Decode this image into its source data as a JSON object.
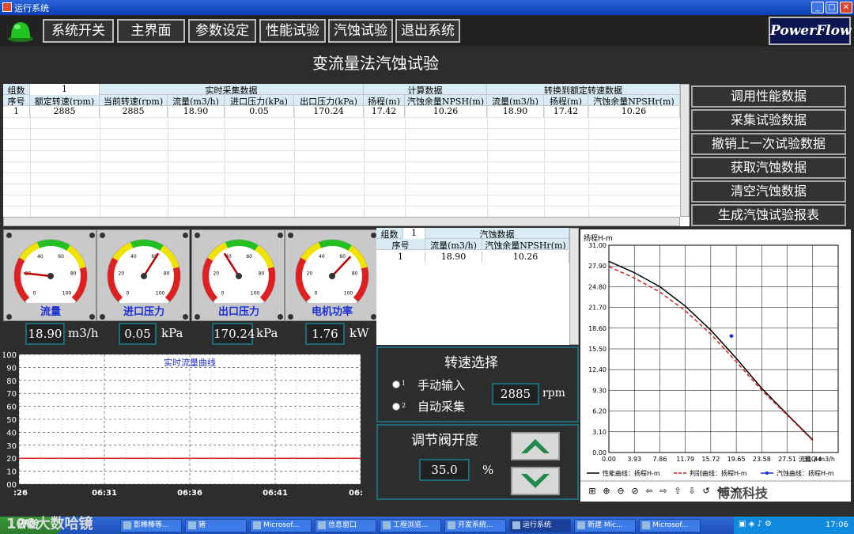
{
  "window": {
    "title": "运行系统"
  },
  "menu": {
    "items": [
      "系统开关",
      "主界面",
      "参数设定",
      "性能试验",
      "汽蚀试验",
      "退出系统"
    ],
    "logo": "PowerFlow"
  },
  "page": {
    "title": "变流量法汽蚀试验"
  },
  "table": {
    "group_label": "组数",
    "group_value": "1",
    "sections": [
      "实时采集数据",
      "计算数据",
      "转换到额定转速数据"
    ],
    "columns": [
      "序号",
      "额定转速(rpm)",
      "当前转速(rpm)",
      "流量(m3/h)",
      "进口压力(kPa)",
      "出口压力(kPa)",
      "扬程(m)",
      "汽蚀余量NPSH(m)",
      "流量(m3/h)",
      "扬程(m)",
      "汽蚀余量NPSHr(m)"
    ],
    "rows": [
      [
        "1",
        "2885",
        "2885",
        "18.90",
        "0.05",
        "170.24",
        "17.42",
        "10.26",
        "18.90",
        "17.42",
        "10.26"
      ]
    ]
  },
  "actions": [
    "调用性能数据",
    "采集试验数据",
    "撤销上一次试验数据",
    "获取汽蚀数据",
    "清空汽蚀数据",
    "生成汽蚀试验报表"
  ],
  "gauges": [
    {
      "label": "流量",
      "value": "18.90",
      "unit": "m3/h",
      "level": 0.19,
      "ticks": [
        "0",
        "20",
        "40",
        "60",
        "80",
        "100"
      ]
    },
    {
      "label": "进口压力",
      "value": "0.05",
      "unit": "kPa",
      "level": 0.62,
      "ticks": [
        "0",
        "20",
        "40",
        "60",
        "80",
        "100"
      ]
    },
    {
      "label": "出口压力",
      "value": "170.24",
      "unit": "kPa",
      "level": 0.38,
      "ticks": [
        "0",
        "20",
        "40",
        "60",
        "80",
        "100"
      ]
    },
    {
      "label": "电机功率",
      "value": "1.76",
      "unit": "kW",
      "level": 0.66,
      "ticks": [
        "0",
        "20",
        "40",
        "60",
        "80",
        "100"
      ]
    }
  ],
  "npsh_table": {
    "group_label": "组数",
    "group_value": "1",
    "section": "汽蚀数据",
    "columns": [
      "序号",
      "流量(m3/h)",
      "汽蚀余量NPSHr(m)"
    ],
    "rows": [
      [
        "1",
        "18.90",
        "10.26"
      ]
    ]
  },
  "trend": {
    "title": "实时流量曲线",
    "y_ticks": [
      "100",
      "90",
      "80",
      "70",
      "60",
      "50",
      "40",
      "30",
      "20",
      "10",
      "00"
    ],
    "x_ticks": [
      ":26",
      "06:31",
      "06:36",
      "06:41",
      "06:"
    ],
    "level": 20
  },
  "speed": {
    "title": "转速选择",
    "options": [
      {
        "num": "1",
        "label": "手动输入"
      },
      {
        "num": "2",
        "label": "自动采集"
      }
    ],
    "value": "2885",
    "unit": "rpm"
  },
  "valve": {
    "title": "调节阀开度",
    "value": "35.0",
    "unit": "%"
  },
  "chart_data": {
    "type": "line",
    "ylabel": "扬程H-m",
    "xlabel": "流量Q-m3/h",
    "y_ticks": [
      "31.00",
      "27.90",
      "24.80",
      "21.70",
      "18.60",
      "15.50",
      "12.40",
      "9.30",
      "6.20",
      "3.10",
      "0.00"
    ],
    "x_ticks": [
      "0.00",
      "3.93",
      "7.86",
      "11.79",
      "15.72",
      "19.65",
      "23.58",
      "27.51",
      "31.44"
    ],
    "ylim": [
      0,
      31
    ],
    "xlim": [
      0,
      35.37
    ],
    "grid": true,
    "series": [
      {
        "name": "性能曲线：扬程H-m",
        "color": "#000000",
        "style": "solid",
        "x": [
          0,
          3.93,
          7.86,
          11.79,
          15.72,
          19.65,
          23.58,
          27.51,
          31.44
        ],
        "y": [
          28.6,
          26.9,
          24.8,
          21.9,
          18.3,
          14.1,
          9.6,
          5.7,
          1.9
        ]
      },
      {
        "name": "判别曲线：扬程H-m",
        "color": "#d22020",
        "style": "dashed",
        "x": [
          0,
          3.93,
          7.86,
          11.79,
          15.72,
          19.65,
          23.58,
          27.51,
          31.44
        ],
        "y": [
          27.8,
          26.1,
          24.0,
          21.2,
          17.7,
          13.6,
          9.3,
          5.6,
          1.8
        ]
      },
      {
        "name": "汽蚀曲线：扬程H-m",
        "color": "#1a2fd6",
        "style": "marker",
        "x": [
          18.9
        ],
        "y": [
          17.42
        ]
      }
    ]
  },
  "curve_toolbar": [
    "⊞",
    "⊕",
    "⊖",
    "⊘",
    "⇦",
    "⇨",
    "⇧",
    "⇩",
    "↺",
    "✥",
    "✕"
  ],
  "taskbar": {
    "start": "开始",
    "tasks": [
      "影棒棒等...",
      "猪",
      "Microsof...",
      "信息窗口",
      "工程浏览...",
      "开发系统...",
      "运行系统",
      "新建 Mic...",
      "Microsof..."
    ],
    "clock": "17:06"
  },
  "watermarks": [
    "博流科技",
    "100大数哈镜"
  ]
}
